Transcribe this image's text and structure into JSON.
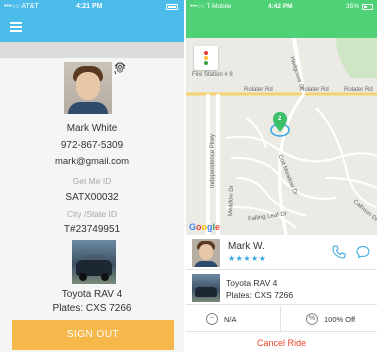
{
  "left": {
    "status_bar": {
      "carrier": "•••○○ AT&T",
      "time": "4:21 PM"
    },
    "profile": {
      "name": "Mark White",
      "phone": "972-867-5309",
      "email": "mark@gmail.com",
      "getme_label": "Get Me ID",
      "getme_value": "SATX00032",
      "city_label": "City /State ID",
      "city_value": "T#23749951"
    },
    "car": {
      "model": "Toyota RAV 4",
      "plates": "Plates: CXS 7266"
    },
    "signout_label": "SIGN OUT",
    "accent_color": "#4bbce9",
    "button_color": "#f7b84b"
  },
  "right": {
    "status_bar": {
      "carrier": "•••○○ T-Mobile",
      "time": "4:42 PM",
      "battery": "35%"
    },
    "map": {
      "labels": {
        "fire_station": "Fire Station # 8",
        "rolater_left": "Rolater Rd",
        "rolater_mid": "Rolater Rd",
        "rolater_right": "Rolater Rd",
        "independence": "Independence Pkwy",
        "hedgcoxe": "Hedgcoxe Dr",
        "coit_meadow": "Coit Meadow Dr",
        "meadow": "Meadow Dr",
        "falling_leaf": "Falling Leaf Dr",
        "calhoun": "Calhoun Dr"
      },
      "pin_label": "2",
      "google": [
        "G",
        "o",
        "o",
        "g",
        "l",
        "e"
      ]
    },
    "driver": {
      "name": "Mark W.",
      "stars": "★★★★★"
    },
    "car": {
      "line1": "Toyota RAV 4",
      "line2": "Plates: CXS 7266"
    },
    "promo": {
      "left_text": "N/A",
      "right_icon": "%",
      "right_text": "100% Off"
    },
    "cancel_label": "Cancel Ride",
    "accent_color": "#4fd178"
  }
}
